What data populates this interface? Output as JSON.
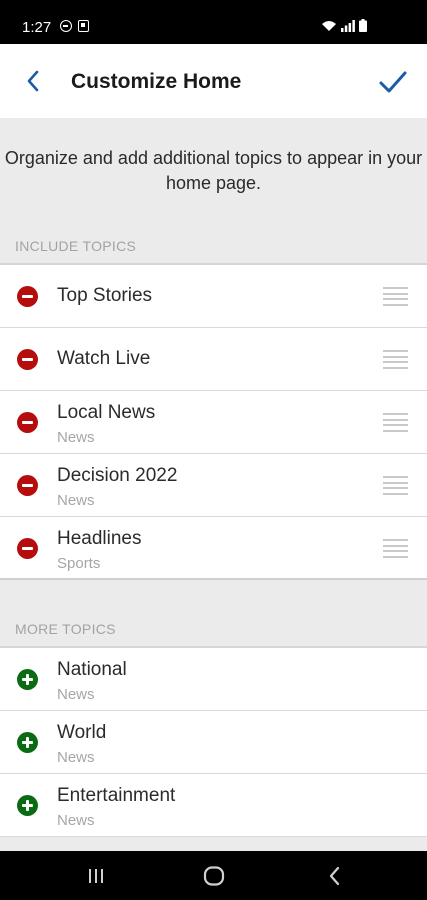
{
  "status_bar": {
    "time": "1:27"
  },
  "header": {
    "title": "Customize Home"
  },
  "intro": {
    "text": "Organize and add additional topics to appear in your home page."
  },
  "include_section": {
    "label": "INCLUDE TOPICS",
    "items": [
      {
        "title": "Top Stories",
        "subtitle": ""
      },
      {
        "title": "Watch Live",
        "subtitle": ""
      },
      {
        "title": "Local News",
        "subtitle": "News"
      },
      {
        "title": "Decision 2022",
        "subtitle": "News"
      },
      {
        "title": "Headlines",
        "subtitle": "Sports"
      }
    ]
  },
  "more_section": {
    "label": "MORE TOPICS",
    "items": [
      {
        "title": "National",
        "subtitle": "News"
      },
      {
        "title": "World",
        "subtitle": "News"
      },
      {
        "title": "Entertainment",
        "subtitle": "News"
      }
    ]
  },
  "colors": {
    "accent": "#1a5ca8",
    "remove": "#b50d0d",
    "add": "#0b6b12"
  },
  "icons": {
    "back": "chevron-left-icon",
    "done": "checkmark-icon",
    "remove": "remove-circle-icon",
    "add": "add-circle-icon",
    "drag": "drag-handle-icon"
  }
}
